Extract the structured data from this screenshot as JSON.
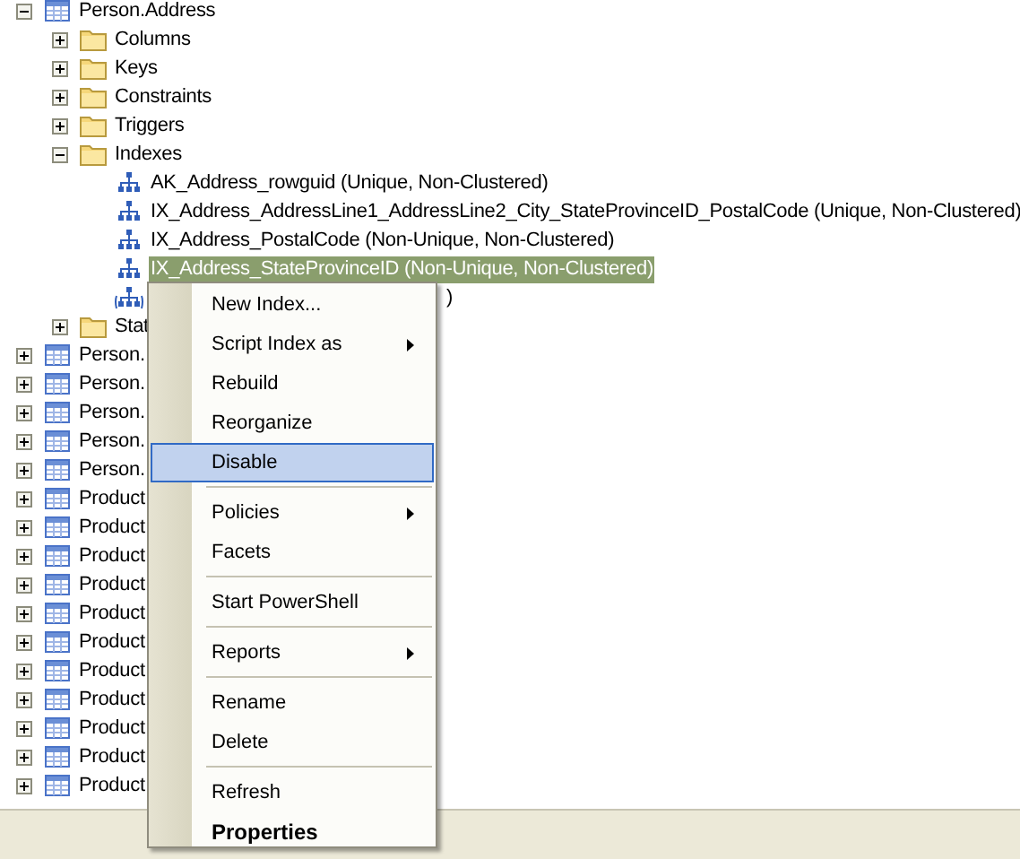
{
  "tree": [
    {
      "label": "Person.Address",
      "kind": "table",
      "expanded": true,
      "selected": false,
      "children": [
        {
          "label": "Columns",
          "kind": "folder",
          "expanded": false,
          "selected": false
        },
        {
          "label": "Keys",
          "kind": "folder",
          "expanded": false,
          "selected": false
        },
        {
          "label": "Constraints",
          "kind": "folder",
          "expanded": false,
          "selected": false
        },
        {
          "label": "Triggers",
          "kind": "folder",
          "expanded": false,
          "selected": false
        },
        {
          "label": "Indexes",
          "kind": "folder",
          "expanded": true,
          "selected": false,
          "children": [
            {
              "label": "AK_Address_rowguid (Unique, Non-Clustered)",
              "kind": "index",
              "selected": false
            },
            {
              "label": "IX_Address_AddressLine1_AddressLine2_City_StateProvinceID_PostalCode (Unique, Non-Clustered)",
              "kind": "index",
              "selected": false
            },
            {
              "label": "IX_Address_PostalCode (Non-Unique, Non-Clustered)",
              "kind": "index",
              "selected": false
            },
            {
              "label": "IX_Address_StateProvinceID (Non-Unique, Non-Clustered)",
              "kind": "index",
              "selected": true
            },
            {
              "label": ")",
              "kind": "clustered-index",
              "selected": false
            }
          ]
        },
        {
          "label": "Stat",
          "kind": "folder",
          "expanded": false,
          "selected": false
        }
      ]
    },
    {
      "label": "Person.",
      "kind": "table",
      "expanded": false,
      "selected": false
    },
    {
      "label": "Person.",
      "kind": "table",
      "expanded": false,
      "selected": false
    },
    {
      "label": "Person.",
      "kind": "table",
      "expanded": false,
      "selected": false
    },
    {
      "label": "Person.",
      "kind": "table",
      "expanded": false,
      "selected": false
    },
    {
      "label": "Person.",
      "kind": "table",
      "expanded": false,
      "selected": false
    },
    {
      "label": "Product",
      "kind": "table",
      "expanded": false,
      "selected": false
    },
    {
      "label": "Product",
      "kind": "table",
      "expanded": false,
      "selected": false
    },
    {
      "label": "Product",
      "kind": "table",
      "expanded": false,
      "selected": false
    },
    {
      "label": "Product",
      "kind": "table",
      "expanded": false,
      "selected": false
    },
    {
      "label": "Product",
      "kind": "table",
      "expanded": false,
      "selected": false
    },
    {
      "label": "Product",
      "kind": "table",
      "expanded": false,
      "selected": false
    },
    {
      "label": "Product",
      "kind": "table",
      "expanded": false,
      "selected": false
    },
    {
      "label": "Product",
      "kind": "table",
      "expanded": false,
      "selected": false
    },
    {
      "label": "Product",
      "kind": "table",
      "expanded": false,
      "selected": false
    },
    {
      "label": "Product",
      "kind": "table",
      "expanded": false,
      "selected": false
    },
    {
      "label": "Product",
      "kind": "table",
      "expanded": false,
      "selected": false
    }
  ],
  "context_menu": [
    {
      "kind": "item",
      "label": "New Index...",
      "selected": false,
      "submenu": false,
      "default": false
    },
    {
      "kind": "item",
      "label": "Script Index as",
      "selected": false,
      "submenu": true,
      "default": false
    },
    {
      "kind": "item",
      "label": "Rebuild",
      "selected": false,
      "submenu": false,
      "default": false
    },
    {
      "kind": "item",
      "label": "Reorganize",
      "selected": false,
      "submenu": false,
      "default": false
    },
    {
      "kind": "item",
      "label": "Disable",
      "selected": true,
      "submenu": false,
      "default": false
    },
    {
      "kind": "separator"
    },
    {
      "kind": "item",
      "label": "Policies",
      "selected": false,
      "submenu": true,
      "default": false
    },
    {
      "kind": "item",
      "label": "Facets",
      "selected": false,
      "submenu": false,
      "default": false
    },
    {
      "kind": "separator"
    },
    {
      "kind": "item",
      "label": "Start PowerShell",
      "selected": false,
      "submenu": false,
      "default": false
    },
    {
      "kind": "separator"
    },
    {
      "kind": "item",
      "label": "Reports",
      "selected": false,
      "submenu": true,
      "default": false
    },
    {
      "kind": "separator"
    },
    {
      "kind": "item",
      "label": "Rename",
      "selected": false,
      "submenu": false,
      "default": false
    },
    {
      "kind": "item",
      "label": "Delete",
      "selected": false,
      "submenu": false,
      "default": false
    },
    {
      "kind": "separator"
    },
    {
      "kind": "item",
      "label": "Refresh",
      "selected": false,
      "submenu": false,
      "default": false
    },
    {
      "kind": "item",
      "label": "Properties",
      "selected": false,
      "submenu": false,
      "default": true
    }
  ]
}
